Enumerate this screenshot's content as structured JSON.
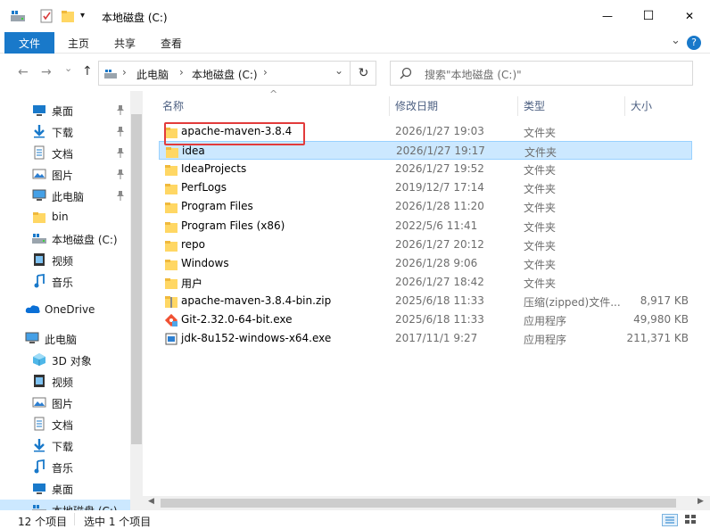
{
  "window": {
    "title": "本地磁盘 (C:)",
    "minimize": "—",
    "maximize": "☐",
    "close": "✕"
  },
  "ribbon": {
    "tabs": [
      "文件",
      "主页",
      "共享",
      "查看"
    ],
    "chevron": "⌄",
    "help": "?"
  },
  "address": {
    "crumbs": [
      "此电脑",
      "本地磁盘 (C:)"
    ],
    "sep": "›",
    "back": "←",
    "forward": "→",
    "recent": "⌄",
    "up": "↑",
    "dropdown": "⌄",
    "refresh": "↻"
  },
  "search": {
    "placeholder": "搜索\"本地磁盘 (C:)\""
  },
  "sidebar": {
    "items": [
      {
        "label": "桌面",
        "icon": "desktop-icon",
        "pinned": true
      },
      {
        "label": "下载",
        "icon": "download-icon",
        "pinned": true
      },
      {
        "label": "文档",
        "icon": "document-icon",
        "pinned": true
      },
      {
        "label": "图片",
        "icon": "picture-icon",
        "pinned": true
      },
      {
        "label": "此电脑",
        "icon": "computer-icon",
        "pinned": true
      },
      {
        "label": "bin",
        "icon": "folder-icon",
        "pinned": false
      },
      {
        "label": "本地磁盘 (C:)",
        "icon": "drive-icon",
        "pinned": false
      },
      {
        "label": "视频",
        "icon": "video-icon",
        "pinned": false
      },
      {
        "label": "音乐",
        "icon": "music-icon",
        "pinned": false
      },
      {
        "label": "OneDrive",
        "icon": "cloud-icon",
        "pinned": false
      },
      {
        "label": "此电脑",
        "icon": "computer-icon",
        "pinned": false
      },
      {
        "label": "3D 对象",
        "icon": "cube-icon",
        "pinned": false
      },
      {
        "label": "视频",
        "icon": "video-icon",
        "pinned": false
      },
      {
        "label": "图片",
        "icon": "picture-icon",
        "pinned": false
      },
      {
        "label": "文档",
        "icon": "document-icon",
        "pinned": false
      },
      {
        "label": "下载",
        "icon": "download-icon",
        "pinned": false
      },
      {
        "label": "音乐",
        "icon": "music-icon",
        "pinned": false
      },
      {
        "label": "桌面",
        "icon": "desktop-icon",
        "pinned": false
      },
      {
        "label": "本地磁盘 (C:)",
        "icon": "drive-icon",
        "pinned": false
      }
    ],
    "pin_glyph": "📌"
  },
  "columns": {
    "name": "名称",
    "date": "修改日期",
    "type": "类型",
    "size": "大小",
    "sort_arrow": "^"
  },
  "files": [
    {
      "name": "apache-maven-3.8.4",
      "date": "2026/1/27 19:03",
      "type": "文件夹",
      "size": "",
      "icon": "folder-icon"
    },
    {
      "name": "idea",
      "date": "2026/1/27 19:17",
      "type": "文件夹",
      "size": "",
      "icon": "folder-icon"
    },
    {
      "name": "IdeaProjects",
      "date": "2026/1/27 19:52",
      "type": "文件夹",
      "size": "",
      "icon": "folder-icon"
    },
    {
      "name": "PerfLogs",
      "date": "2019/12/7 17:14",
      "type": "文件夹",
      "size": "",
      "icon": "folder-icon"
    },
    {
      "name": "Program Files",
      "date": "2026/1/28 11:20",
      "type": "文件夹",
      "size": "",
      "icon": "folder-icon"
    },
    {
      "name": "Program Files (x86)",
      "date": "2022/5/6 11:41",
      "type": "文件夹",
      "size": "",
      "icon": "folder-icon"
    },
    {
      "name": "repo",
      "date": "2026/1/27 20:12",
      "type": "文件夹",
      "size": "",
      "icon": "folder-icon"
    },
    {
      "name": "Windows",
      "date": "2026/1/28 9:06",
      "type": "文件夹",
      "size": "",
      "icon": "folder-icon"
    },
    {
      "name": "用户",
      "date": "2026/1/27 18:42",
      "type": "文件夹",
      "size": "",
      "icon": "folder-icon"
    },
    {
      "name": "apache-maven-3.8.4-bin.zip",
      "date": "2025/6/18 11:33",
      "type": "压缩(zipped)文件...",
      "size": "8,917 KB",
      "icon": "zip-icon"
    },
    {
      "name": "Git-2.32.0-64-bit.exe",
      "date": "2025/6/18 11:33",
      "type": "应用程序",
      "size": "49,980 KB",
      "icon": "git-icon"
    },
    {
      "name": "jdk-8u152-windows-x64.exe",
      "date": "2017/11/1 9:27",
      "type": "应用程序",
      "size": "211,371 KB",
      "icon": "installer-icon"
    }
  ],
  "selected_index": 1,
  "status": {
    "count": "12 个项目",
    "selection": "选中 1 个项目"
  },
  "colors": {
    "accent": "#1979ca",
    "selected": "#cce8ff",
    "highlight": "#e23b3b",
    "folder": "#ffd764"
  }
}
